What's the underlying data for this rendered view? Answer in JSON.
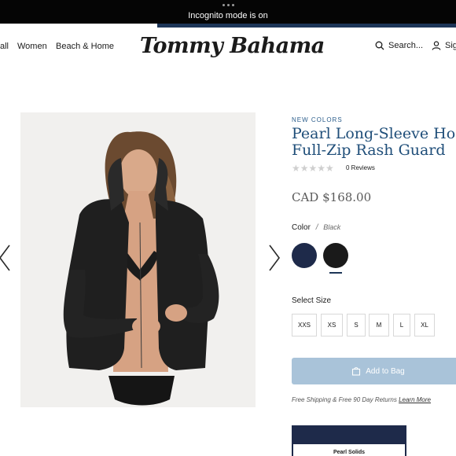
{
  "browser": {
    "incognito_text": "Incognito mode is on"
  },
  "header": {
    "nav_items": [
      {
        "label": "all"
      },
      {
        "label": "Women"
      },
      {
        "label": "Beach & Home"
      }
    ],
    "logo_text": "Tommy Bahama",
    "logo_mark": "®",
    "search_label": "Search...",
    "signin_label": "Sig",
    "icons": {
      "search": "search-icon",
      "account": "user-icon"
    }
  },
  "product": {
    "eyebrow": "NEW COLORS",
    "title_line1": "Pearl Long-Sleeve Hoo",
    "title_line2": "Full-Zip Rash Guard",
    "rating_stars": "★★★★★",
    "rating_value": 0,
    "reviews_text": "0 Reviews",
    "price": "CAD $168.00",
    "color_label": "Color",
    "color_separator": "/",
    "selected_color": "Black",
    "colors": [
      {
        "name": "Navy",
        "hex": "#1e2a4a"
      },
      {
        "name": "Black",
        "hex": "#1a1a1a"
      }
    ],
    "size_label": "Select Size",
    "sizes": [
      "XXS",
      "XS",
      "S",
      "M",
      "L",
      "XL"
    ],
    "add_to_bag": "Add to Bag",
    "shipping_text": "Free Shipping & Free 90 Day Returns",
    "learn_more": "Learn More",
    "card_label": "Pearl Solids"
  },
  "colors": {
    "brand_blue": "#1f4e79",
    "cta_disabled": "#a9c3d9",
    "stripe": "#1d3557"
  }
}
